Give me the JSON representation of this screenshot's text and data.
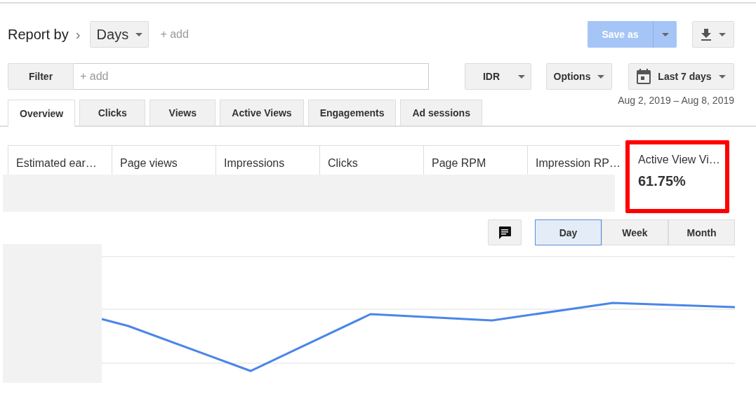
{
  "report_by": {
    "label": "Report by",
    "separator": "›",
    "dimension": "Days",
    "add": "+ add"
  },
  "save_button": {
    "label": "Save as",
    "disabled": true
  },
  "filter": {
    "label": "Filter",
    "placeholder": "+ add"
  },
  "currency": "IDR",
  "options": "Options",
  "date_range": {
    "label": "Last 7 days",
    "dates": "Aug 2, 2019 – Aug 8, 2019"
  },
  "tabs": [
    {
      "label": "Overview",
      "selected": true
    },
    {
      "label": "Clicks",
      "selected": false
    },
    {
      "label": "Views",
      "selected": false
    },
    {
      "label": "Active Views",
      "selected": false
    },
    {
      "label": "Engagements",
      "selected": false
    },
    {
      "label": "Ad sessions",
      "selected": false
    }
  ],
  "metrics": [
    {
      "label": "Estimated ear…",
      "highlighted": false
    },
    {
      "label": "Page views",
      "highlighted": false
    },
    {
      "label": "Impressions",
      "highlighted": false
    },
    {
      "label": "Clicks",
      "highlighted": false
    },
    {
      "label": "Page RPM",
      "highlighted": false
    },
    {
      "label": "Impression RP…",
      "highlighted": false
    },
    {
      "label": "Active View Vi…",
      "value": "61.75%",
      "highlighted": true
    }
  ],
  "granularity": [
    {
      "label": "Day",
      "selected": true
    },
    {
      "label": "Week",
      "selected": false
    },
    {
      "label": "Month",
      "selected": false
    }
  ]
}
